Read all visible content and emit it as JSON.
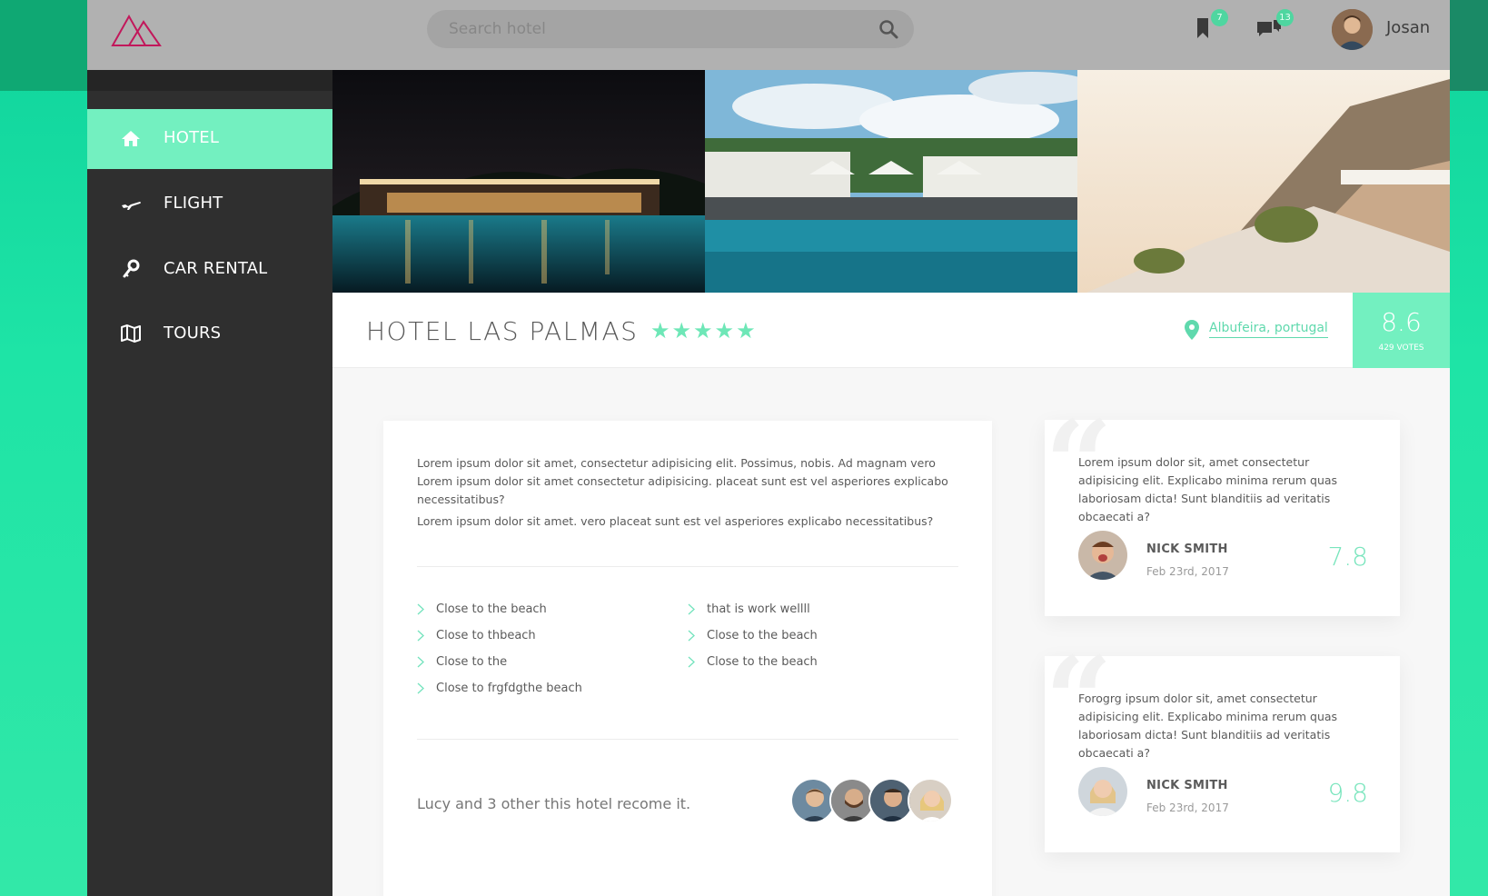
{
  "header": {
    "search_placeholder": "Search hotel",
    "bookmarks_count": "7",
    "messages_count": "13",
    "user_name": "Josan"
  },
  "sidebar": {
    "items": [
      {
        "label": "HOTEL",
        "icon": "home-icon",
        "active": true
      },
      {
        "label": "FLIGHT",
        "icon": "plane-icon",
        "active": false
      },
      {
        "label": "CAR RENTAL",
        "icon": "key-icon",
        "active": false
      },
      {
        "label": "TOURS",
        "icon": "map-icon",
        "active": false
      }
    ]
  },
  "hotel": {
    "name": "HOTEL LAS PALMAS",
    "stars": "★★★★★",
    "location": "Albufeira, portugal",
    "score": "8.6",
    "votes": "429 VOTES"
  },
  "description": {
    "paragraph_1": "Lorem ipsum dolor sit amet, consectetur adipisicing elit. Possimus, nobis. Ad magnam vero Lorem ipsum dolor sit amet consectetur adipisicing. placeat sunt est vel asperiores explicabo necessitatibus?",
    "paragraph_2": "Lorem ipsum dolor sit amet. vero placeat sunt est vel asperiores explicabo necessitatibus?",
    "features_left": [
      "Close to the beach",
      "Close to thbeach",
      "Close to the",
      "Close to frgfdgthe beach"
    ],
    "features_right": [
      "that is work wellll",
      "Close to the beach",
      "Close to the beach"
    ],
    "recommend_text": "Lucy and 3 other this hotel recome it."
  },
  "reviews": [
    {
      "text": "Lorem ipsum dolor sit, amet consectetur adipisicing elit. Explicabo minima rerum quas laboriosam dicta! Sunt blanditiis ad veritatis obcaecati a?",
      "name": "NICK SMITH",
      "date": "Feb 23rd, 2017",
      "score": "7.8"
    },
    {
      "text": "Forogrg ipsum dolor sit, amet consectetur adipisicing elit. Explicabo minima rerum quas laboriosam dicta! Sunt blanditiis ad veritatis obcaecati a?",
      "name": "NICK SMITH",
      "date": "Feb 23rd, 2017",
      "score": "9.8"
    }
  ],
  "colors": {
    "accent": "#73f0c0",
    "sidebar": "#2f2f2f",
    "header": "#b1b1b1",
    "logo": "#c2185b"
  }
}
